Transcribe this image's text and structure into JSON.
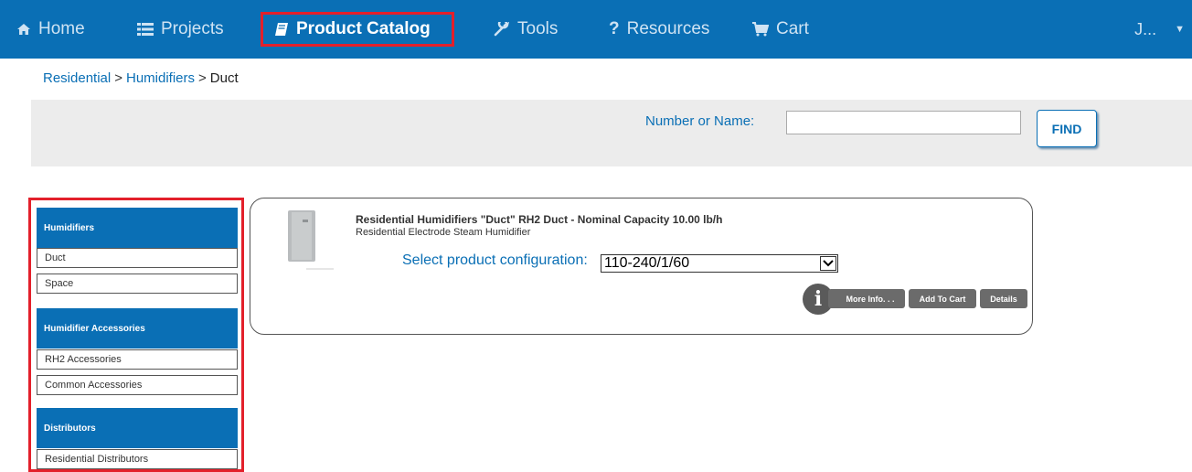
{
  "nav": {
    "items": [
      {
        "label": "Home",
        "icon": "home-icon"
      },
      {
        "label": "Projects",
        "icon": "list-icon"
      },
      {
        "label": "Product Catalog",
        "icon": "book-icon",
        "active": true
      },
      {
        "label": "Tools",
        "icon": "wrench-icon"
      },
      {
        "label": "Resources",
        "icon": "question-icon"
      },
      {
        "label": "Cart",
        "icon": "cart-icon"
      }
    ],
    "user": "J...",
    "accent": "#0a6fb5",
    "highlight": "#e3202b"
  },
  "breadcrumb": {
    "items": [
      "Residential",
      "Humidifiers",
      "Duct"
    ],
    "separator": ">"
  },
  "search": {
    "label": "Number or Name:",
    "value": "",
    "button": "FIND"
  },
  "sidebar": {
    "sections": [
      {
        "title": "Humidifiers",
        "items": [
          "Duct",
          "Space"
        ]
      },
      {
        "title": "Humidifier Accessories",
        "items": [
          "RH2 Accessories",
          "Common Accessories"
        ]
      },
      {
        "title": "Distributors",
        "items": [
          "Residential Distributors"
        ]
      }
    ]
  },
  "product": {
    "title": "Residential Humidifiers \"Duct\" RH2 Duct - Nominal Capacity 10.00 lb/h",
    "subtitle": "Residential Electrode Steam Humidifier",
    "config_label": "Select product configuration:",
    "config_value": "110-240/1/60",
    "info_icon": "info-icon",
    "buttons": {
      "more_info": "More Info. . .",
      "add_to_cart": "Add To Cart",
      "details": "Details"
    }
  }
}
